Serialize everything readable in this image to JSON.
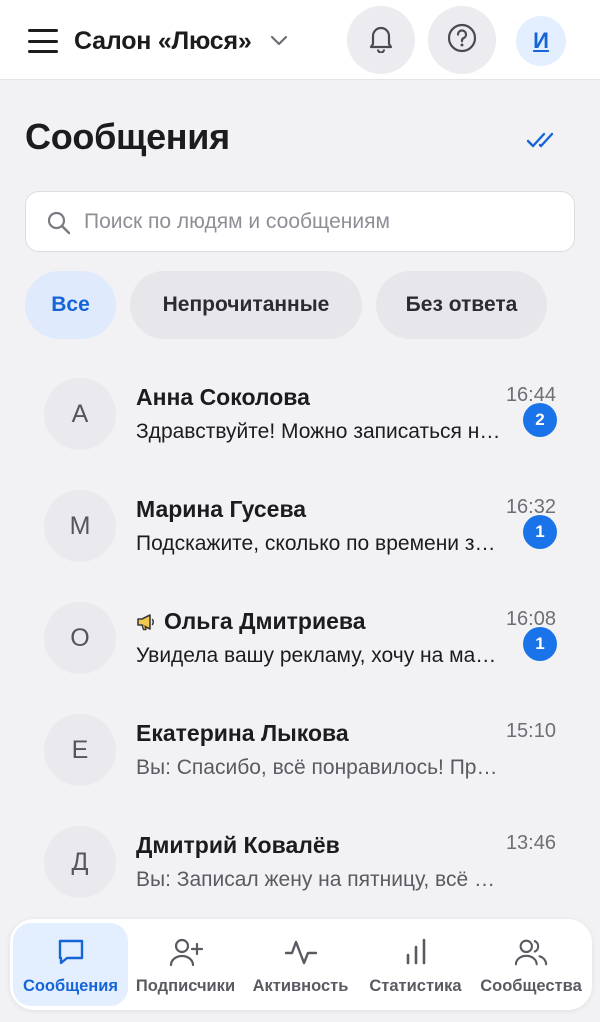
{
  "header": {
    "org_name": "Салон «Люся»",
    "avatar_initial": "И",
    "icons": [
      "menu-icon",
      "chevron-down-icon",
      "bell-icon",
      "help-icon"
    ]
  },
  "page": {
    "title": "Сообщения",
    "read_all_icon": "double-check-icon"
  },
  "search": {
    "placeholder": "Поиск по людям и сообщениям",
    "value": ""
  },
  "filters": [
    {
      "label": "Все",
      "active": true
    },
    {
      "label": "Непрочитанные",
      "active": false
    },
    {
      "label": "Без ответа",
      "active": false
    }
  ],
  "conversations": [
    {
      "initial": "А",
      "name": "Анна Соколова",
      "time": "16:44",
      "preview": "Здравствуйте! Можно записаться на стрижку в субботу?",
      "unread": "2",
      "ad": false,
      "own": false
    },
    {
      "initial": "М",
      "name": "Марина Гусева",
      "time": "16:32",
      "preview": "Подскажите, сколько по времени займёт окрашивание?",
      "unread": "1",
      "ad": false,
      "own": false
    },
    {
      "initial": "О",
      "name": "Ольга Дмитриева",
      "time": "16:08",
      "preview": "Увидела вашу рекламу, хочу на маникюр",
      "unread": "1",
      "ad": true,
      "own": false
    },
    {
      "initial": "Е",
      "name": "Екатерина Лыкова",
      "time": "15:10",
      "preview": "Вы: Спасибо, всё понравилось! Приходите ещё",
      "unread": "",
      "ad": false,
      "own": true
    },
    {
      "initial": "Д",
      "name": "Дмитрий Ковалёв",
      "time": "13:46",
      "preview": "Вы: Записал жену на пятницу, всё верно",
      "unread": "",
      "ad": false,
      "own": true
    }
  ],
  "bottom_nav": [
    {
      "label": "Сообщения",
      "icon": "chat-icon",
      "active": true
    },
    {
      "label": "Подписчики",
      "icon": "user-plus-icon",
      "active": false
    },
    {
      "label": "Активность",
      "icon": "activity-icon",
      "active": false
    },
    {
      "label": "Статистика",
      "icon": "bar-chart-icon",
      "active": false
    },
    {
      "label": "Сообщества",
      "icon": "users-icon",
      "active": false
    }
  ],
  "colors": {
    "accent": "#1565d8",
    "badge": "#1a73e8",
    "chip_active_bg": "#dfeafd",
    "background": "#f2f2f4"
  }
}
